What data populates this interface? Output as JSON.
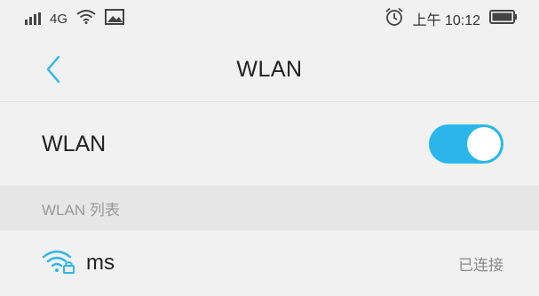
{
  "status_bar": {
    "signal_icon": "signal-bars-icon",
    "network_type": "4G",
    "wifi_icon": "wifi-icon",
    "image_icon": "image-icon",
    "alarm_icon": "alarm-clock-icon",
    "time": "上午 10:12",
    "battery_icon": "battery-icon"
  },
  "nav": {
    "back_icon": "chevron-left-icon",
    "title": "WLAN"
  },
  "wlan_toggle": {
    "label": "WLAN",
    "enabled": true,
    "accent_color": "#2bb6ea"
  },
  "section": {
    "title": "WLAN 列表"
  },
  "networks": [
    {
      "name": "ms",
      "icon": "wifi-lock-icon",
      "status": "已连接"
    }
  ]
}
